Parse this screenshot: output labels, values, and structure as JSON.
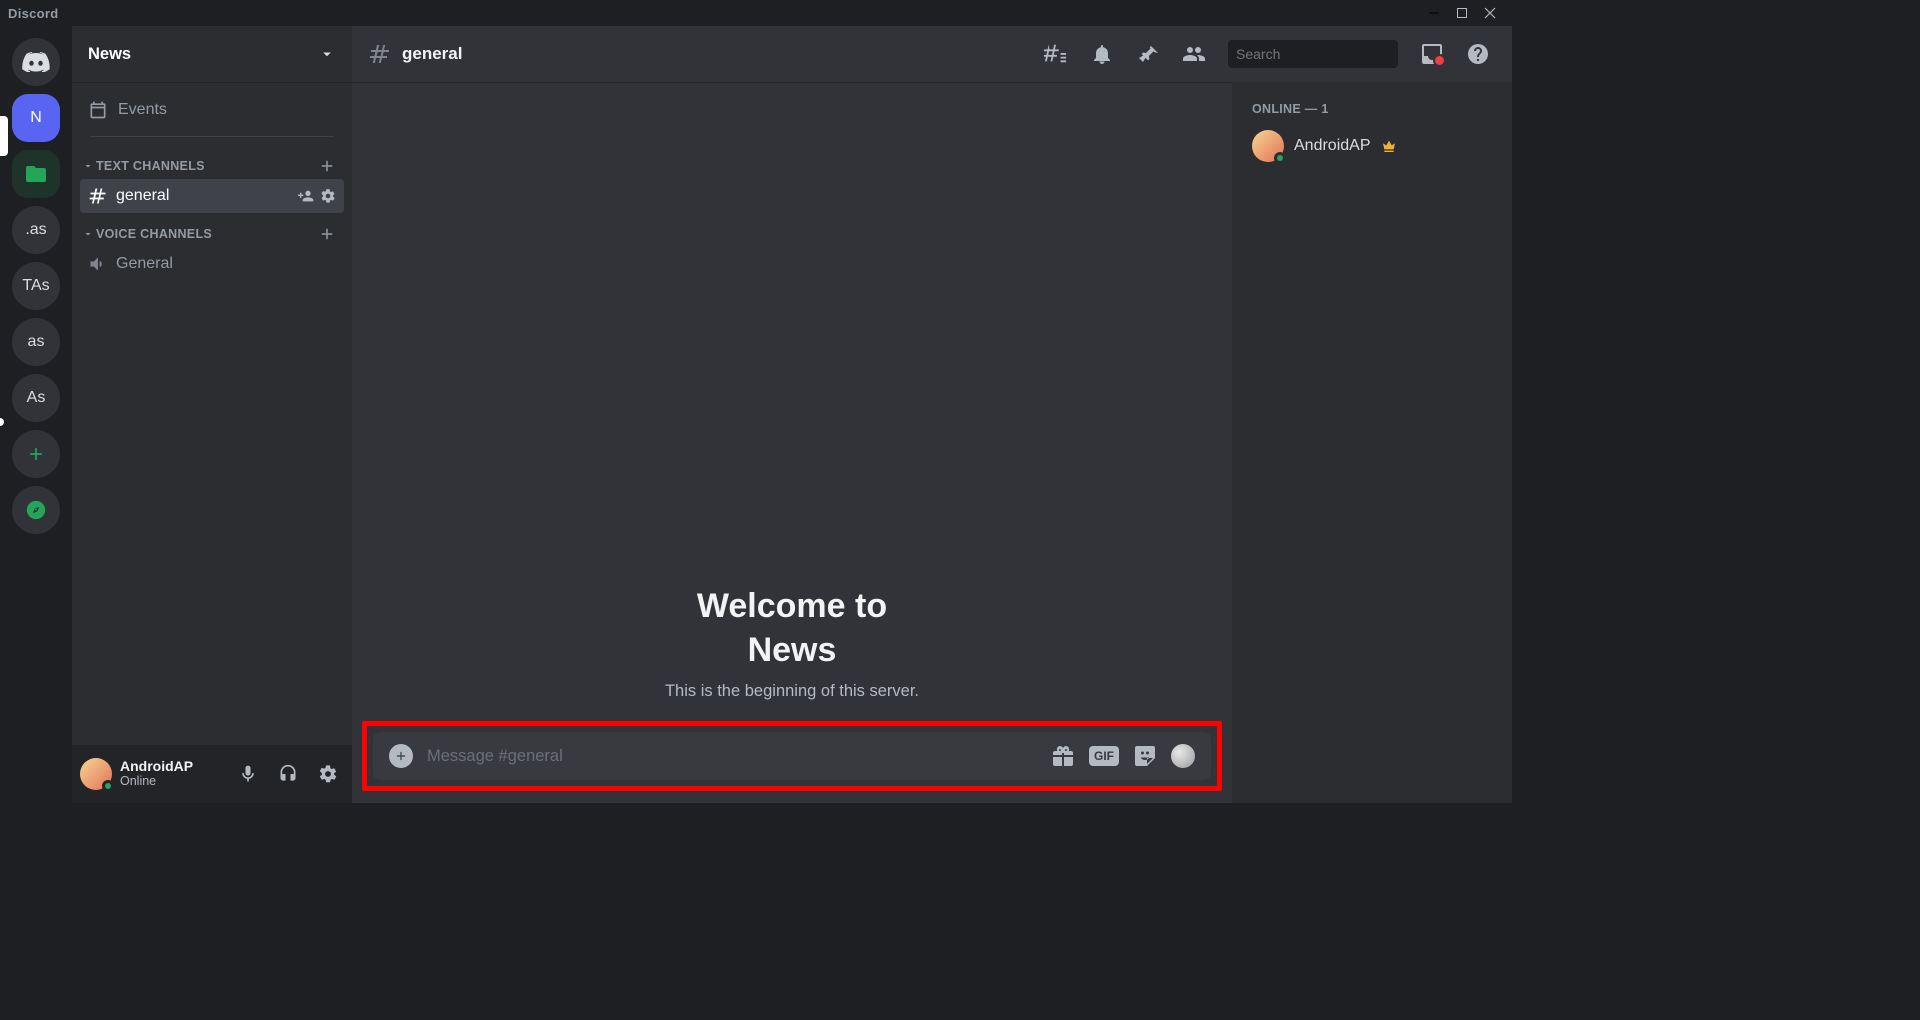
{
  "titlebar": {
    "app_name": "Discord"
  },
  "guilds": {
    "selected_initial": "N",
    "items": [
      {
        "label": ".as"
      },
      {
        "label": "TAs"
      },
      {
        "label": "as"
      },
      {
        "label": "As"
      }
    ]
  },
  "sidebar": {
    "server_name": "News",
    "events_label": "Events",
    "text_channels_label": "TEXT CHANNELS",
    "voice_channels_label": "VOICE CHANNELS",
    "text_channels": [
      {
        "name": "general",
        "selected": true
      }
    ],
    "voice_channels": [
      {
        "name": "General"
      }
    ]
  },
  "user_panel": {
    "username": "AndroidAP",
    "status": "Online"
  },
  "toolbar": {
    "channel_name": "general",
    "search_placeholder": "Search"
  },
  "welcome": {
    "line1": "Welcome to",
    "line2": "News",
    "subtitle": "This is the beginning of this server."
  },
  "composer": {
    "placeholder": "Message #general",
    "gif_label": "GIF"
  },
  "members": {
    "heading": "ONLINE — 1",
    "list": [
      {
        "name": "AndroidAP",
        "owner": true
      }
    ]
  }
}
